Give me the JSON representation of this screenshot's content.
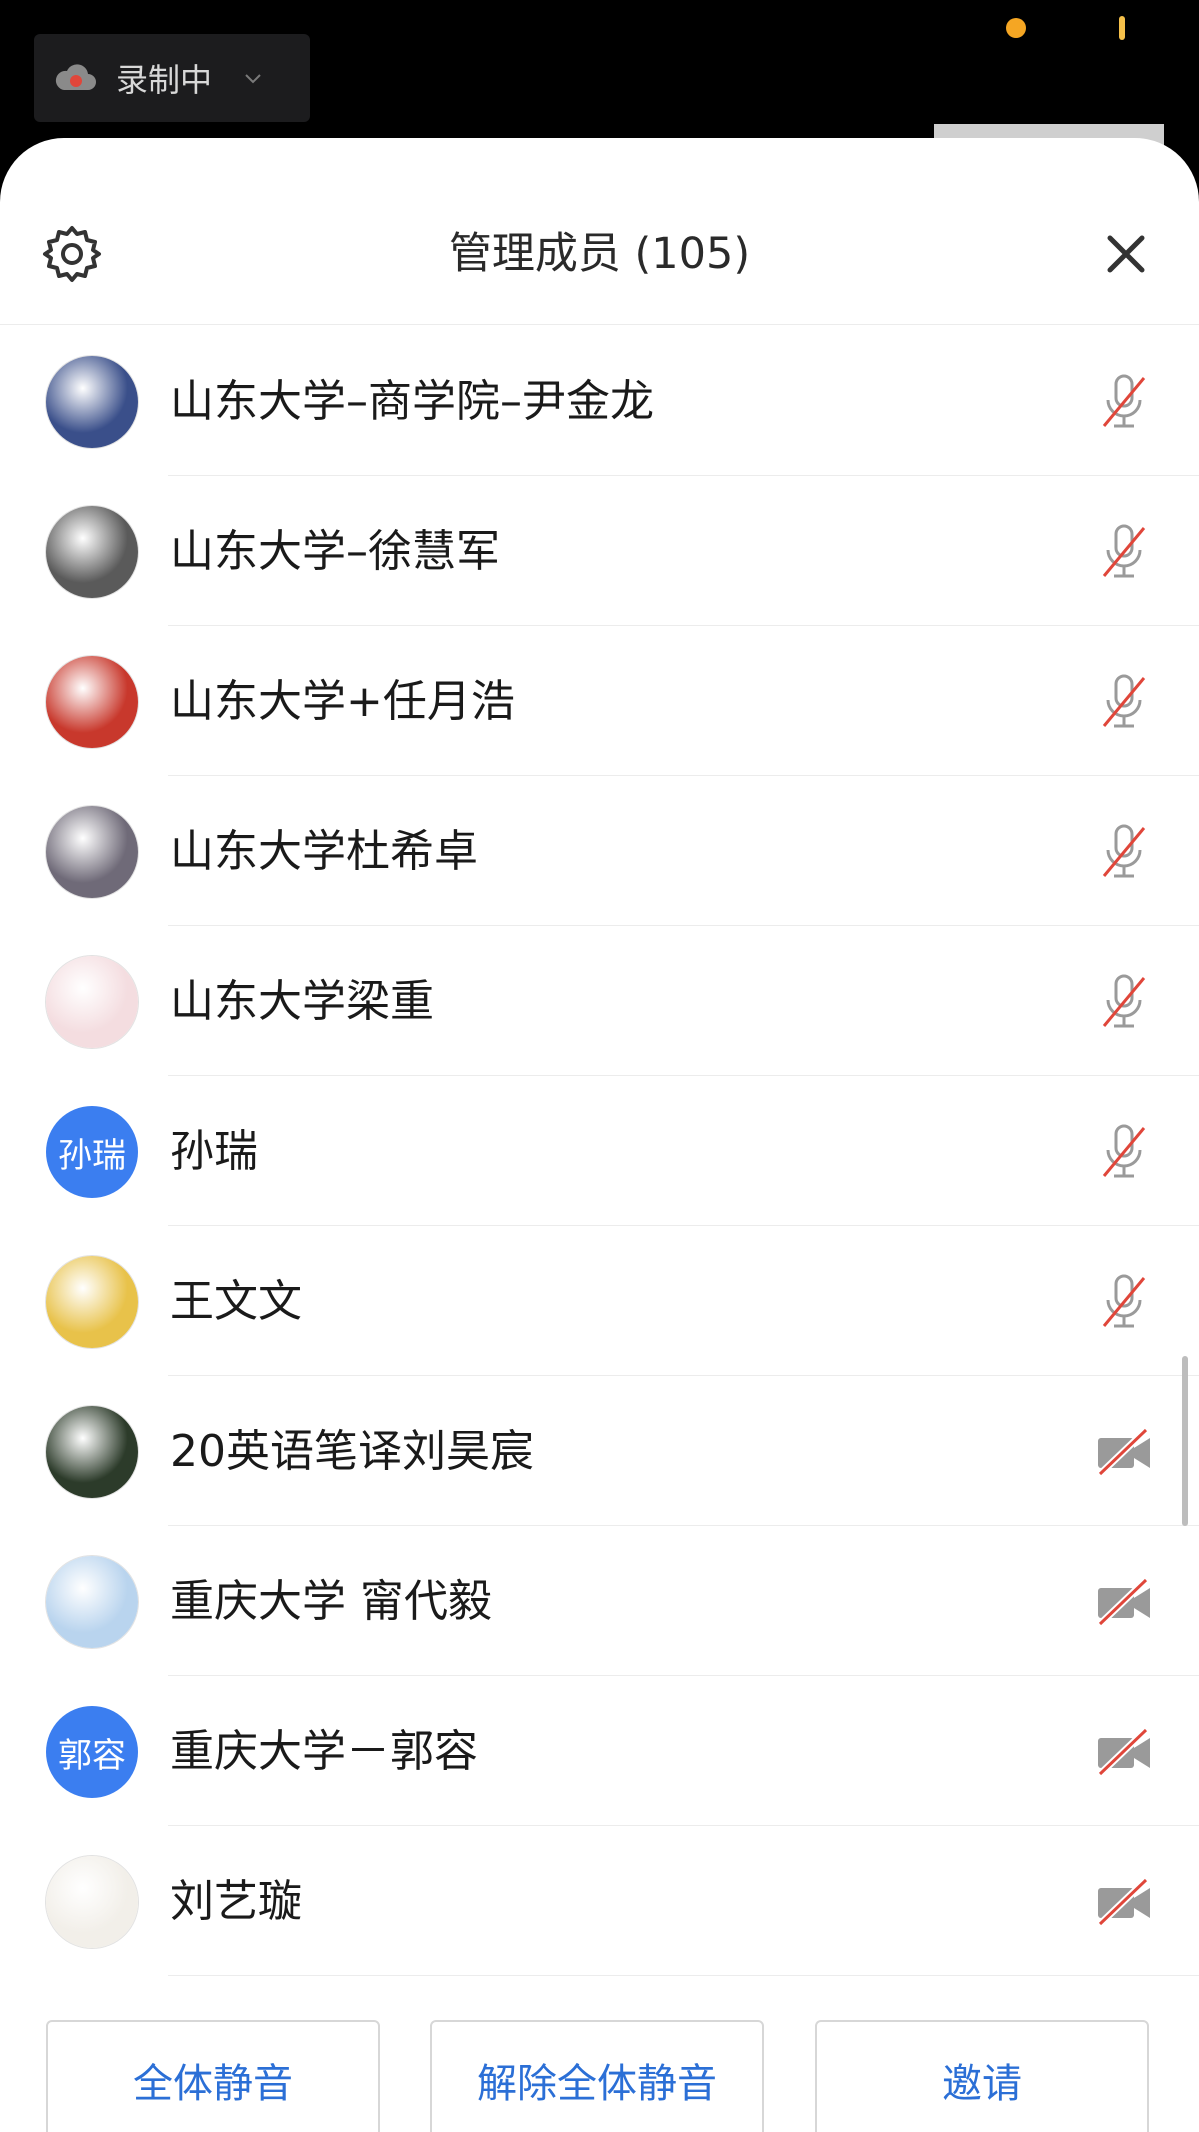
{
  "status": {
    "recording_label": "录制中",
    "icons": [
      "cloud-icon",
      "chevron-down-icon"
    ]
  },
  "header": {
    "title": "管理成员 (105)",
    "icons": [
      "gear-icon",
      "close-icon"
    ]
  },
  "members": [
    {
      "name": "山东大学–商学院–尹金龙",
      "avatar_type": "photo",
      "avatar_color": "#3a4f8a",
      "media": "mic-muted-icon"
    },
    {
      "name": "山东大学–徐慧军",
      "avatar_type": "photo",
      "avatar_color": "#5a5a5a",
      "media": "mic-muted-icon"
    },
    {
      "name": "山东大学+任月浩",
      "avatar_type": "photo",
      "avatar_color": "#c8382c",
      "media": "mic-muted-icon"
    },
    {
      "name": "山东大学杜希卓",
      "avatar_type": "photo",
      "avatar_color": "#6f6a78",
      "media": "mic-muted-icon"
    },
    {
      "name": "山东大学梁重",
      "avatar_type": "photo",
      "avatar_color": "#f4dde0",
      "media": "mic-muted-icon"
    },
    {
      "name": "孙瑞",
      "avatar_type": "text",
      "avatar_text": "孙瑞",
      "avatar_color": "#3b7ef0",
      "media": "mic-muted-icon"
    },
    {
      "name": "王文文",
      "avatar_type": "photo",
      "avatar_color": "#e8c24a",
      "media": "mic-muted-icon"
    },
    {
      "name": "20英语笔译刘昊宸",
      "avatar_type": "photo",
      "avatar_color": "#2c3b2a",
      "media": "camera-off-icon"
    },
    {
      "name": "重庆大学 甯代毅",
      "avatar_type": "photo",
      "avatar_color": "#b9d4ee",
      "media": "camera-off-icon"
    },
    {
      "name": "重庆大学－郭容",
      "avatar_type": "text",
      "avatar_text": "郭容",
      "avatar_color": "#3b7ef0",
      "media": "camera-off-icon"
    },
    {
      "name": "刘艺璇",
      "avatar_type": "photo",
      "avatar_color": "#f2efe9",
      "media": "camera-off-icon"
    }
  ],
  "actions": {
    "mute_all": "全体静音",
    "unmute_all": "解除全体静音",
    "invite": "邀请"
  },
  "colors": {
    "accent": "#2b6fd6",
    "muted_slash": "#e0463a",
    "recording_dot": "#f5a623"
  }
}
